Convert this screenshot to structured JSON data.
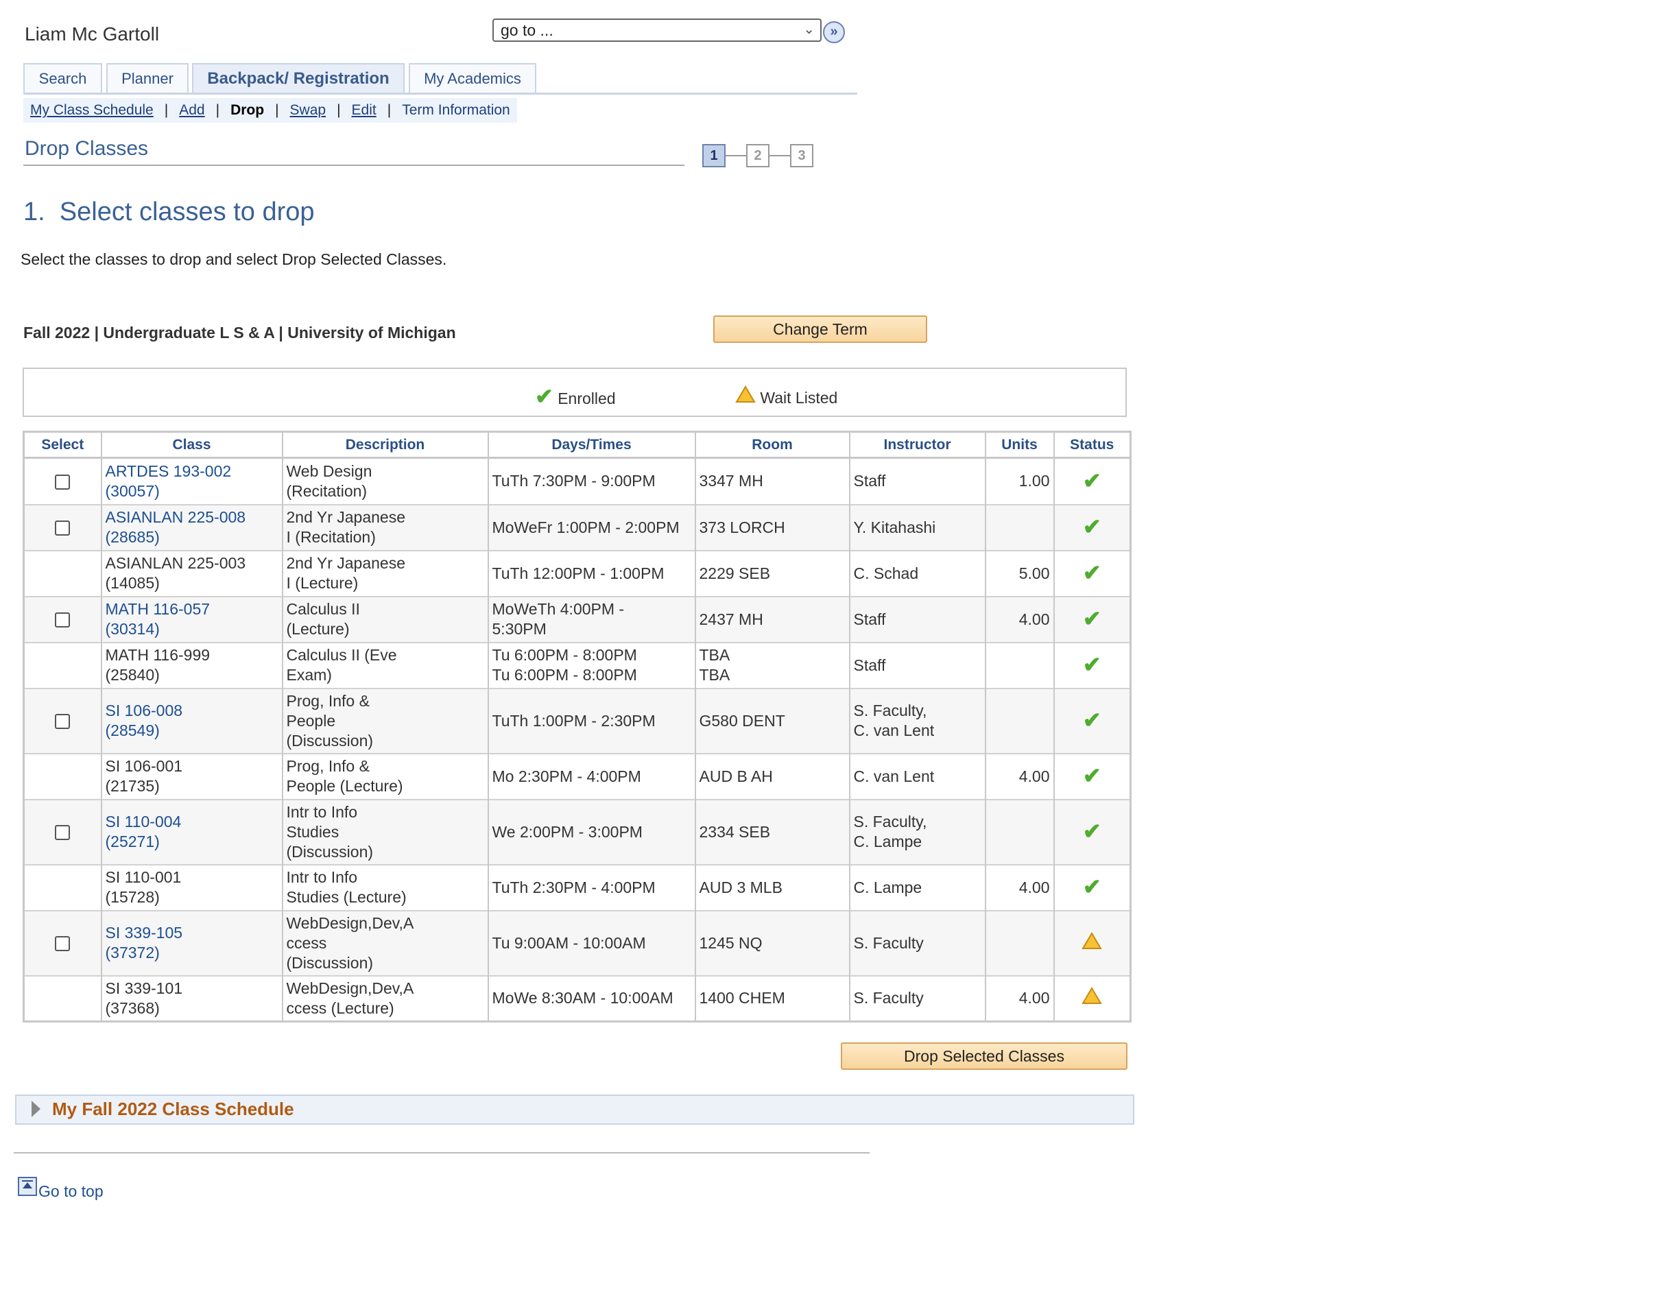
{
  "user": {
    "name": "Liam Mc Gartoll"
  },
  "goto": {
    "value": "go to ...",
    "button_icon": "double-chevron-right-icon"
  },
  "tabs": [
    {
      "label": "Search"
    },
    {
      "label": "Planner"
    },
    {
      "label": "Backpack/ Registration"
    },
    {
      "label": "My Academics"
    }
  ],
  "subnav": {
    "my_class_schedule": "My Class Schedule",
    "add": "Add",
    "drop": "Drop",
    "swap": "Swap",
    "edit": "Edit",
    "term_information": "Term Information",
    "separator": "|"
  },
  "page": {
    "title": "Drop Classes",
    "steps": [
      "1",
      "2",
      "3"
    ],
    "current_step": 1,
    "heading": "1.  Select classes to drop",
    "instructions": "Select the classes to drop and select Drop Selected Classes.",
    "term": "Fall 2022 | Undergraduate L S & A | University of Michigan",
    "change_term_label": "Change Term"
  },
  "legend": {
    "enrolled": "Enrolled",
    "wait_listed": "Wait Listed"
  },
  "table": {
    "headers": [
      "Select",
      "Class",
      "Description",
      "Days/Times",
      "Room",
      "Instructor",
      "Units",
      "Status"
    ],
    "rows": [
      {
        "selectable": true,
        "class1": "ARTDES 193-002",
        "class2": "(30057)",
        "desc": [
          "Web Design",
          "(Recitation)"
        ],
        "times": [
          "TuTh 7:30PM - 9:00PM"
        ],
        "room": [
          "3347 MH"
        ],
        "instructor": [
          "Staff"
        ],
        "units": "1.00",
        "status": "enrolled"
      },
      {
        "selectable": true,
        "class1": "ASIANLAN 225-008",
        "class2": "(28685)",
        "desc": [
          "2nd Yr Japanese",
          "I (Recitation)"
        ],
        "times": [
          "MoWeFr 1:00PM - 2:00PM"
        ],
        "room": [
          "373 LORCH"
        ],
        "instructor": [
          "Y. Kitahashi"
        ],
        "units": "",
        "status": "enrolled"
      },
      {
        "selectable": false,
        "class1": "ASIANLAN 225-003",
        "class2": "(14085)",
        "desc": [
          "2nd Yr Japanese",
          "I (Lecture)"
        ],
        "times": [
          "TuTh 12:00PM - 1:00PM"
        ],
        "room": [
          "2229 SEB"
        ],
        "instructor": [
          "C. Schad"
        ],
        "units": "5.00",
        "status": "enrolled"
      },
      {
        "selectable": true,
        "class1": "MATH 116-057",
        "class2": "(30314)",
        "desc": [
          "Calculus II",
          "(Lecture)"
        ],
        "times": [
          "MoWeTh 4:00PM -",
          "5:30PM"
        ],
        "room": [
          "2437 MH"
        ],
        "instructor": [
          "Staff"
        ],
        "units": "4.00",
        "status": "enrolled"
      },
      {
        "selectable": false,
        "class1": "MATH 116-999",
        "class2": "(25840)",
        "desc": [
          "Calculus II (Eve",
          "Exam)"
        ],
        "times": [
          "Tu 6:00PM - 8:00PM",
          "Tu 6:00PM - 8:00PM"
        ],
        "room": [
          "TBA",
          "TBA"
        ],
        "instructor": [
          "Staff"
        ],
        "units": "",
        "status": "enrolled"
      },
      {
        "selectable": true,
        "class1": "SI 106-008",
        "class2": "(28549)",
        "desc": [
          "Prog, Info &",
          "People",
          "(Discussion)"
        ],
        "times": [
          "TuTh 1:00PM - 2:30PM"
        ],
        "room": [
          "G580 DENT"
        ],
        "instructor": [
          "S. Faculty,",
          "C. van Lent"
        ],
        "units": "",
        "status": "enrolled"
      },
      {
        "selectable": false,
        "class1": "SI 106-001",
        "class2": "(21735)",
        "desc": [
          "Prog, Info &",
          "People (Lecture)"
        ],
        "times": [
          "Mo 2:30PM - 4:00PM"
        ],
        "room": [
          "AUD B AH"
        ],
        "instructor": [
          "C. van Lent"
        ],
        "units": "4.00",
        "status": "enrolled"
      },
      {
        "selectable": true,
        "class1": "SI 110-004",
        "class2": "(25271)",
        "desc": [
          "Intr to Info",
          "Studies",
          "(Discussion)"
        ],
        "times": [
          "We 2:00PM - 3:00PM"
        ],
        "room": [
          "2334 SEB"
        ],
        "instructor": [
          "S. Faculty,",
          "C. Lampe"
        ],
        "units": "",
        "status": "enrolled"
      },
      {
        "selectable": false,
        "class1": "SI 110-001",
        "class2": "(15728)",
        "desc": [
          "Intr to Info",
          "Studies (Lecture)"
        ],
        "times": [
          "TuTh 2:30PM - 4:00PM"
        ],
        "room": [
          "AUD 3 MLB"
        ],
        "instructor": [
          "C. Lampe"
        ],
        "units": "4.00",
        "status": "enrolled"
      },
      {
        "selectable": true,
        "class1": "SI 339-105",
        "class2": "(37372)",
        "desc": [
          "WebDesign,Dev,A",
          "ccess",
          "(Discussion)"
        ],
        "times": [
          "Tu 9:00AM - 10:00AM"
        ],
        "room": [
          "1245 NQ"
        ],
        "instructor": [
          "S. Faculty"
        ],
        "units": "",
        "status": "waitlisted"
      },
      {
        "selectable": false,
        "class1": "SI 339-101",
        "class2": "(37368)",
        "desc": [
          "WebDesign,Dev,A",
          "ccess (Lecture)"
        ],
        "times": [
          "MoWe 8:30AM - 10:00AM"
        ],
        "room": [
          "1400 CHEM"
        ],
        "instructor": [
          "S. Faculty"
        ],
        "units": "4.00",
        "status": "waitlisted"
      }
    ]
  },
  "actions": {
    "drop_selected_label": "Drop Selected Classes"
  },
  "schedule_section": {
    "title": "My Fall 2022 Class Schedule"
  },
  "footer": {
    "go_to_top": "Go to top"
  },
  "colors": {
    "enrolled": "#4fac2f",
    "waitlisted": "#f3b92a",
    "link": "#1d4f91",
    "heading": "#3a6196",
    "accent_orange": "#b15a12"
  }
}
